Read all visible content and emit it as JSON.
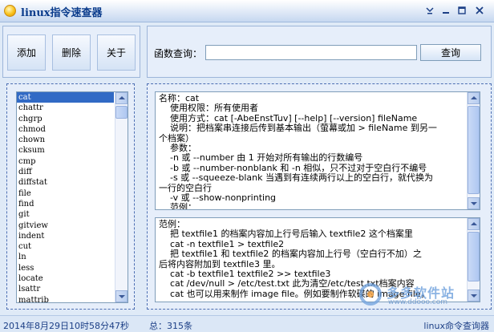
{
  "window": {
    "title": "linux指令速查器",
    "icons": [
      "app-icon",
      "dropdown-icon",
      "minimize-icon",
      "maximize-icon",
      "close-icon"
    ]
  },
  "toolbar": {
    "add_label": "添加",
    "delete_label": "删除",
    "about_label": "关于"
  },
  "query": {
    "label": "函数查询：",
    "value": "",
    "button_label": "查询"
  },
  "commands": {
    "selected": "cat",
    "items": [
      "cat",
      "chattr",
      "chgrp",
      "chmod",
      "chown",
      "cksum",
      "cmp",
      "diff",
      "diffstat",
      "file",
      "find",
      "git",
      "gitview",
      "indent",
      "cut",
      "ln",
      "less",
      "locate",
      "lsattr",
      "mattrib"
    ]
  },
  "detail": {
    "lines": [
      "名称：cat",
      "    使用权限：所有使用者",
      "    使用方式：cat [-AbeEnstTuv] [--help] [--version] fileName",
      "    说明：把档案串连接后传到基本输出（萤幕或加 > fileName 到另一",
      "个档案）",
      "    参数：",
      "    -n 或 --number 由 1 开始对所有输出的行数编号",
      "    -b 或 --number-nonblank 和 -n 相似，只不过对于空白行不编号",
      "    -s 或 --squeeze-blank 当遇到有连续两行以上的空白行，就代换为",
      "一行的空白行",
      "    -v 或 --show-nonprinting",
      "    范例："
    ]
  },
  "example": {
    "lines": [
      "范例：",
      "    把 textfile1 的档案内容加上行号后输入 textfile2 这个档案里",
      "    cat -n textfile1 > textfile2",
      "    把 textfile1 和 textfile2 的档案内容加上行号（空白行不加）之",
      "后将内容附加到 textfile3 里。",
      "    cat -b textfile1 textfile2 >> textfile3",
      "    cat /dev/null > /etc/test.txt 此为清空/etc/test.txt档案内容",
      "    cat 也可以用来制作 image file。例如要制作软碟的 image file，"
    ]
  },
  "watermark": {
    "name": "多多软件站",
    "url": "www.ddooo.com"
  },
  "status": {
    "time": "2014年8月29日10时58分47秒",
    "total": "总：315条",
    "app": "linux命令查询器"
  }
}
